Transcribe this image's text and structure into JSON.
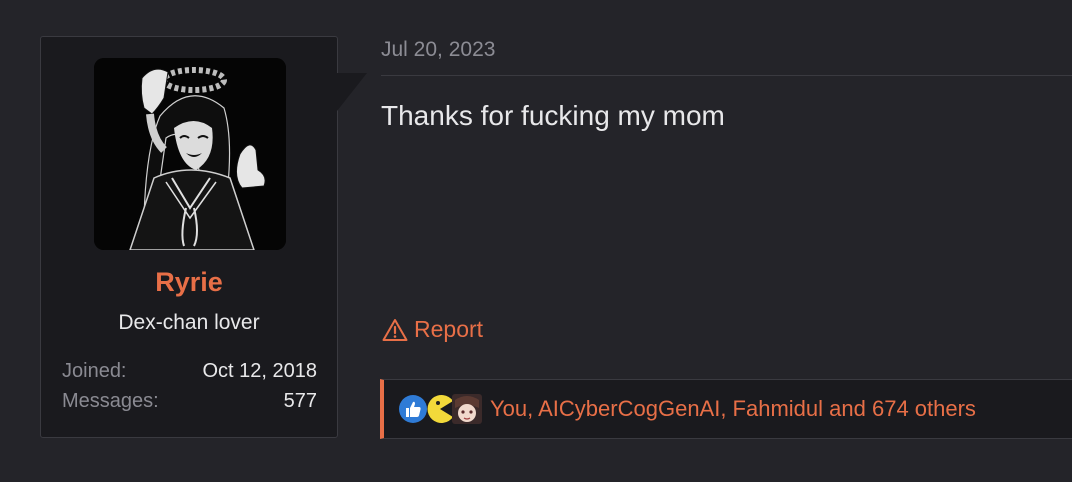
{
  "user": {
    "name": "Ryrie",
    "title": "Dex-chan lover",
    "stats": [
      {
        "label": "Joined:",
        "value": "Oct 12, 2018"
      },
      {
        "label": "Messages:",
        "value": "577"
      }
    ]
  },
  "post": {
    "date": "Jul 20, 2023",
    "body": "Thanks for fucking my mom",
    "report_label": "Report",
    "reactions_text": "You, AICyberCogGenAI, Fahmidul and 674 others"
  },
  "colors": {
    "accent": "#e86f47",
    "background": "#242429",
    "card": "#1a1a1e",
    "text": "#e8e8ea",
    "muted": "#8c8c94",
    "like_blue": "#2f7bd6"
  },
  "icons": [
    "avatar-image",
    "warning-icon",
    "like-reaction-icon",
    "pacman-reaction-icon",
    "anime-face-reaction-icon"
  ]
}
